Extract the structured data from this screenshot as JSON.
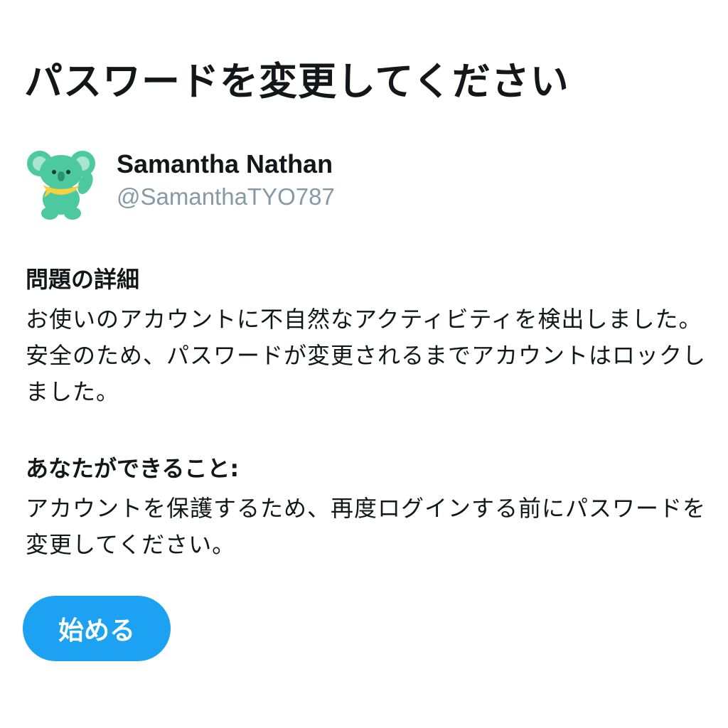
{
  "page": {
    "title": "パスワードを変更してください"
  },
  "user": {
    "display_name": "Samantha Nathan",
    "handle": "@SamanthaTYO787",
    "avatar_icon": "koala-avatar-icon"
  },
  "details": {
    "heading": "問題の詳細",
    "body": "お使いのアカウントに不自然なアクティビティを検出しました。安全のため、パスワードが変更されるまでアカウントはロックしました。"
  },
  "actions": {
    "heading": "あなたができること:",
    "body": "アカウントを保護するため、再度ログインする前にパスワードを変更してください。"
  },
  "button": {
    "label": "始める"
  },
  "colors": {
    "accent": "#1da1f2",
    "text": "#14171a",
    "muted": "#8899a6",
    "avatar_green": "#4dc9a0",
    "avatar_scarf": "#f5d142"
  }
}
